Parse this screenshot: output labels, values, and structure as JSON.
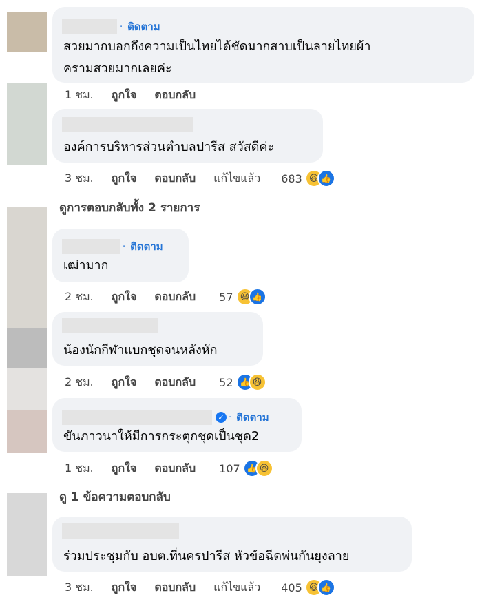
{
  "comments": [
    {
      "follow": "ติดตาม",
      "text_lines": [
        "สวยมากบอกถึงความเป็นไทยได้ชัดมากสาบเป็นลายไทยผ้า",
        "ครามสวยมากเลยค่ะ"
      ],
      "time": "1 ชม.",
      "like": "ถูกใจ",
      "reply": "ตอบกลับ"
    },
    {
      "text_lines": [
        "องค์การบริหารส่วนตำบลปารีส สวัสดีค่ะ"
      ],
      "time": "3 ชม.",
      "like": "ถูกใจ",
      "reply": "ตอบกลับ",
      "edited": "แก้ไขแล้ว",
      "count": "683",
      "view_replies": "ดูการตอบกลับทั้ง 2 รายการ"
    },
    {
      "follow": "ติดตาม",
      "text_lines": [
        "เฒ่ามาก"
      ],
      "time": "2 ชม.",
      "like": "ถูกใจ",
      "reply": "ตอบกลับ",
      "count": "57"
    },
    {
      "text_lines": [
        "น้องนักกีฬาแบกชุดจนหลังหัก"
      ],
      "time": "2 ชม.",
      "like": "ถูกใจ",
      "reply": "ตอบกลับ",
      "count": "52"
    },
    {
      "follow": "ติดตาม",
      "text_lines": [
        "ขันภาวนาให้มีการกระตุกชุดเป็นชุด2"
      ],
      "time": "1 ชม.",
      "like": "ถูกใจ",
      "reply": "ตอบกลับ",
      "count": "107",
      "view_replies": "ดู 1 ข้อความตอบกลับ"
    },
    {
      "text_lines": [
        "ร่วมประชุมกับ อบต.ที่นครปารีส หัวข้อฉีดพ่นกันยุงลาย"
      ],
      "time": "3 ชม.",
      "like": "ถูกใจ",
      "reply": "ตอบกลับ",
      "edited": "แก้ไขแล้ว",
      "count": "405"
    }
  ],
  "icons": {
    "haha": "haha-reaction-icon",
    "like": "like-reaction-icon",
    "verified": "verified-badge-icon"
  },
  "colors": {
    "bubble": "#f0f2f5",
    "follow": "#2474d6",
    "like_blue": "#1b74e4",
    "haha_yellow": "#f7c234"
  }
}
